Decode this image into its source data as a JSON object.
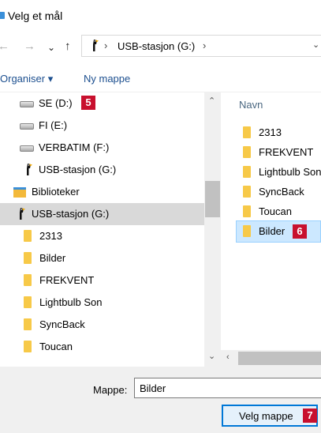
{
  "window": {
    "title": "Velg et mål"
  },
  "nav": {
    "back": "←",
    "forward": "→",
    "recent": "⌄",
    "up": "↑"
  },
  "address": {
    "crumb_sep": "›",
    "location": "USB-stasjon (G:)",
    "dropdown": "⌄"
  },
  "toolbar": {
    "organise_label": "Organiser ▾",
    "new_folder_label": "Ny mappe"
  },
  "tree": {
    "items": [
      {
        "label": "SE (D:)",
        "icon": "drive-icon"
      },
      {
        "label": "FI (E:)",
        "icon": "drive-icon"
      },
      {
        "label": "VERBATIM (F:)",
        "icon": "drive-icon"
      },
      {
        "label": "USB-stasjon (G:)",
        "icon": "usb-toucan-icon"
      },
      {
        "label": "Biblioteker",
        "icon": "library-icon"
      },
      {
        "label": "USB-stasjon (G:)",
        "icon": "usb-toucan-icon",
        "selected": true
      },
      {
        "label": "2313",
        "icon": "folder-icon"
      },
      {
        "label": "Bilder",
        "icon": "folder-icon"
      },
      {
        "label": "FREKVENT",
        "icon": "folder-icon"
      },
      {
        "label": "Lightbulb Son",
        "icon": "folder-icon"
      },
      {
        "label": "SyncBack",
        "icon": "folder-icon"
      },
      {
        "label": "Toucan",
        "icon": "folder-icon"
      }
    ]
  },
  "files": {
    "header": "Navn",
    "items": [
      {
        "label": "2313"
      },
      {
        "label": "FREKVENT"
      },
      {
        "label": "Lightbulb Son"
      },
      {
        "label": "SyncBack"
      },
      {
        "label": "Toucan"
      },
      {
        "label": "Bilder",
        "selected": true
      }
    ]
  },
  "scroll": {
    "up": "⌃",
    "down": "⌄",
    "left": "‹"
  },
  "bottom": {
    "folder_label": "Mappe:",
    "folder_value": "Bilder",
    "select_button": "Velg mappe"
  },
  "badges": {
    "b5": "5",
    "b6": "6",
    "b7": "7"
  },
  "colors": {
    "badge": "#c8102e",
    "accent": "#0078d7",
    "selection": "#cce8ff"
  }
}
